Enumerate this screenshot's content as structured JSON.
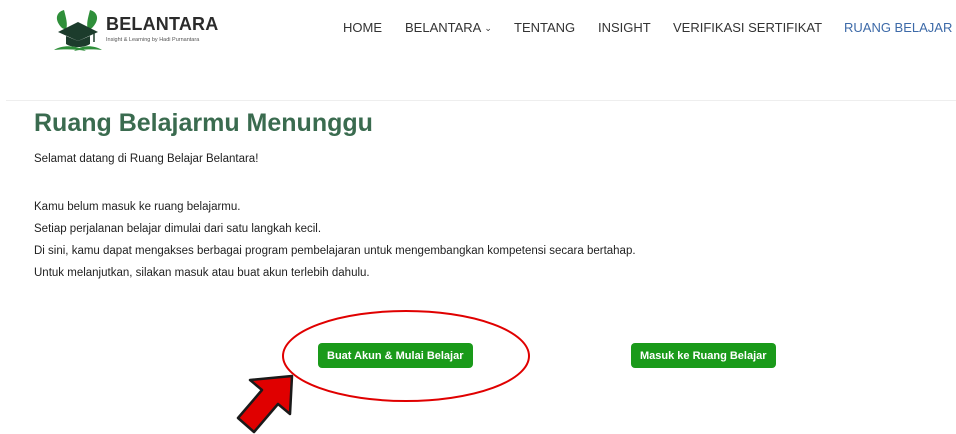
{
  "header": {
    "brand": {
      "name": "BELANTARA",
      "tagline": "Insight & Learning by Hadi Purnantara"
    },
    "nav": [
      {
        "label": "HOME"
      },
      {
        "label": "BELANTARA",
        "icon": "chevron-down-icon"
      },
      {
        "label": "TENTANG"
      },
      {
        "label": "INSIGHT"
      },
      {
        "label": "VERIFIKASI SERTIFIKAT"
      },
      {
        "label": "RUANG BELAJAR",
        "active": true
      }
    ]
  },
  "main": {
    "title": "Ruang Belajarmu Menunggu",
    "welcome": "Selamat datang di Ruang Belajar Belantara!",
    "lines": [
      "Kamu belum masuk ke ruang belajarmu.",
      "Setiap perjalanan belajar dimulai dari satu langkah kecil.",
      "Di sini, kamu dapat mengakses berbagai program pembelajaran untuk mengembangkan kompetensi secara bertahap.",
      "Untuk melanjutkan, silakan masuk atau buat akun terlebih dahulu."
    ],
    "buttons": {
      "register": "Buat Akun & Mulai Belajar",
      "login": "Masuk ke Ruang Belajar"
    }
  },
  "annotations": {
    "highlight": "red-ellipse",
    "pointer": "red-arrow-icon"
  },
  "colors": {
    "title": "#3a6b4f",
    "button": "#1a9a1a",
    "active_nav": "#3d6aa8",
    "annotation": "#e00000"
  }
}
